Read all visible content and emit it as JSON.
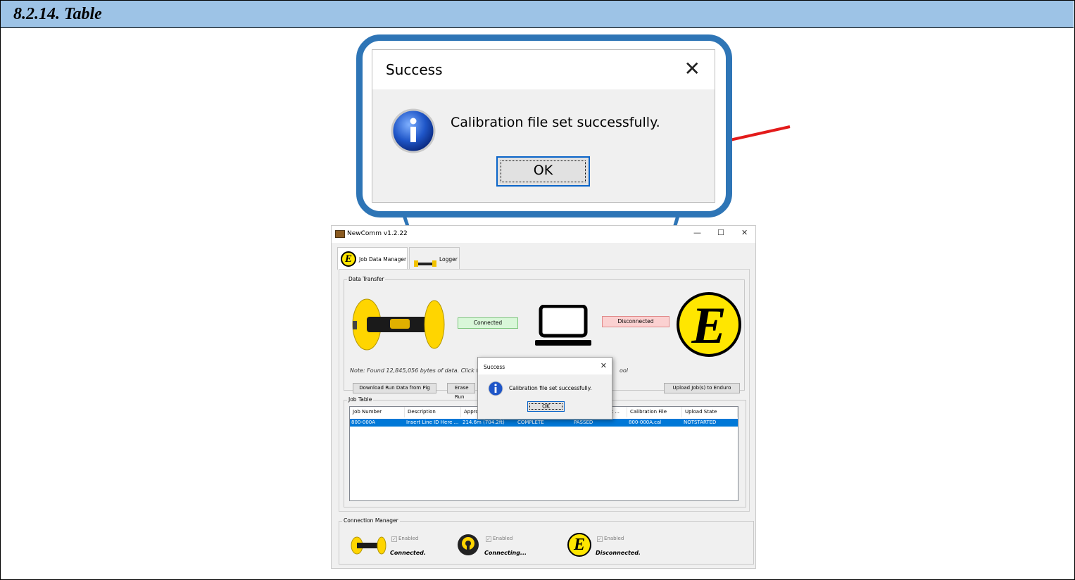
{
  "section_title": "8.2.14. Table",
  "zoom_dialog": {
    "title": "Success",
    "close_glyph": "✕",
    "message": "Calibration file set successfully.",
    "ok_label": "OK",
    "icon": "info-icon"
  },
  "app": {
    "title": "NewComm v1.2.22",
    "controls": {
      "minimize": "—",
      "maximize": "☐",
      "close": "✕"
    },
    "tabs": [
      {
        "label": "Job Data Manager",
        "icon": "enduro-e-icon",
        "selected": true
      },
      {
        "label": "Logger",
        "icon": "logger-tool-icon",
        "selected": false
      }
    ],
    "data_transfer": {
      "group_label": "Data Transfer",
      "pig_status": "Connected",
      "enduro_status": "Disconnected",
      "note": "Note: Found 12,845,056 bytes of data. Click t",
      "note_tail": "ool",
      "download_button": "Download Run Data from Pig",
      "erase_button": "Erase Run",
      "upload_button": "Upload Job(s) to Enduro",
      "logo_letter": "E",
      "colors": {
        "connected_bg": "#d9f7d9",
        "connected_border": "#7bc67b",
        "disconnected_bg": "#fbd1d1",
        "disconnected_border": "#e08a8a"
      }
    },
    "job_table": {
      "group_label": "Job Table",
      "columns": [
        "Job Number",
        "Description",
        "Appro",
        "",
        "",
        "k ...",
        "Calibration File",
        "Upload State"
      ],
      "rows": [
        [
          "800-000A",
          "Insert Line ID Here ...",
          "214.6m (704.2ft)",
          "COMPLETE",
          "PASSED",
          "",
          "800-000A.cal",
          "NOTSTARTED"
        ]
      ],
      "selected_color": "#0078d7"
    },
    "connection_manager": {
      "group_label": "Connection Manager",
      "items": [
        {
          "icon": "pig-icon",
          "enabled_label": "Enabled",
          "status": "Connected."
        },
        {
          "icon": "logger-icon",
          "enabled_label": "Enabled",
          "status": "Connecting..."
        },
        {
          "icon": "enduro-e-icon",
          "enabled_label": "Enabled",
          "status": "Disconnected."
        }
      ]
    },
    "small_dialog": {
      "title": "Success",
      "close_glyph": "✕",
      "message": "Calibration file set successfully.",
      "ok_label": "OK"
    }
  },
  "colors": {
    "header_bg": "#9dc3e6",
    "callout_blue": "#2e75b6",
    "arrow_red": "#e31b1b"
  }
}
